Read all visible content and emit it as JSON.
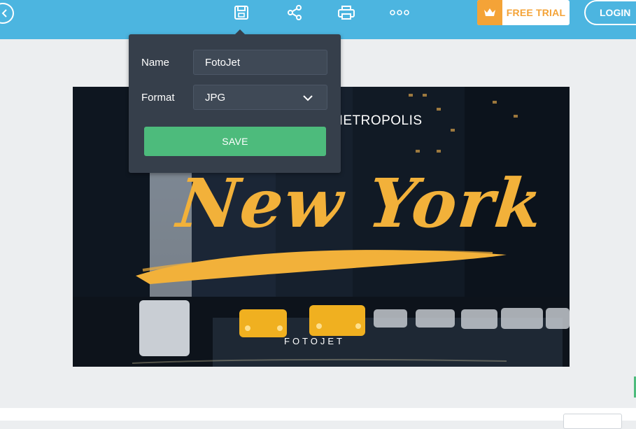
{
  "toolbar": {
    "back_icon": "chevron-left-icon",
    "tools": [
      "save-icon",
      "share-icon",
      "print-icon",
      "more-icon"
    ],
    "free_trial_label": "FREE TRIAL",
    "login_label": "LOGIN"
  },
  "save_dialog": {
    "name_label": "Name",
    "name_value": "FotoJet",
    "format_label": "Format",
    "format_value": "JPG",
    "save_label": "SAVE"
  },
  "design": {
    "subtitle": "METROPOLIS",
    "title": "New York",
    "watermark": "FOTOJET"
  },
  "colors": {
    "topbar": "#4cb5e0",
    "accent_orange": "#f4a337",
    "save_green": "#4dbb7c",
    "dialog_bg": "#363f4b",
    "script_yellow": "#f2b13a"
  }
}
